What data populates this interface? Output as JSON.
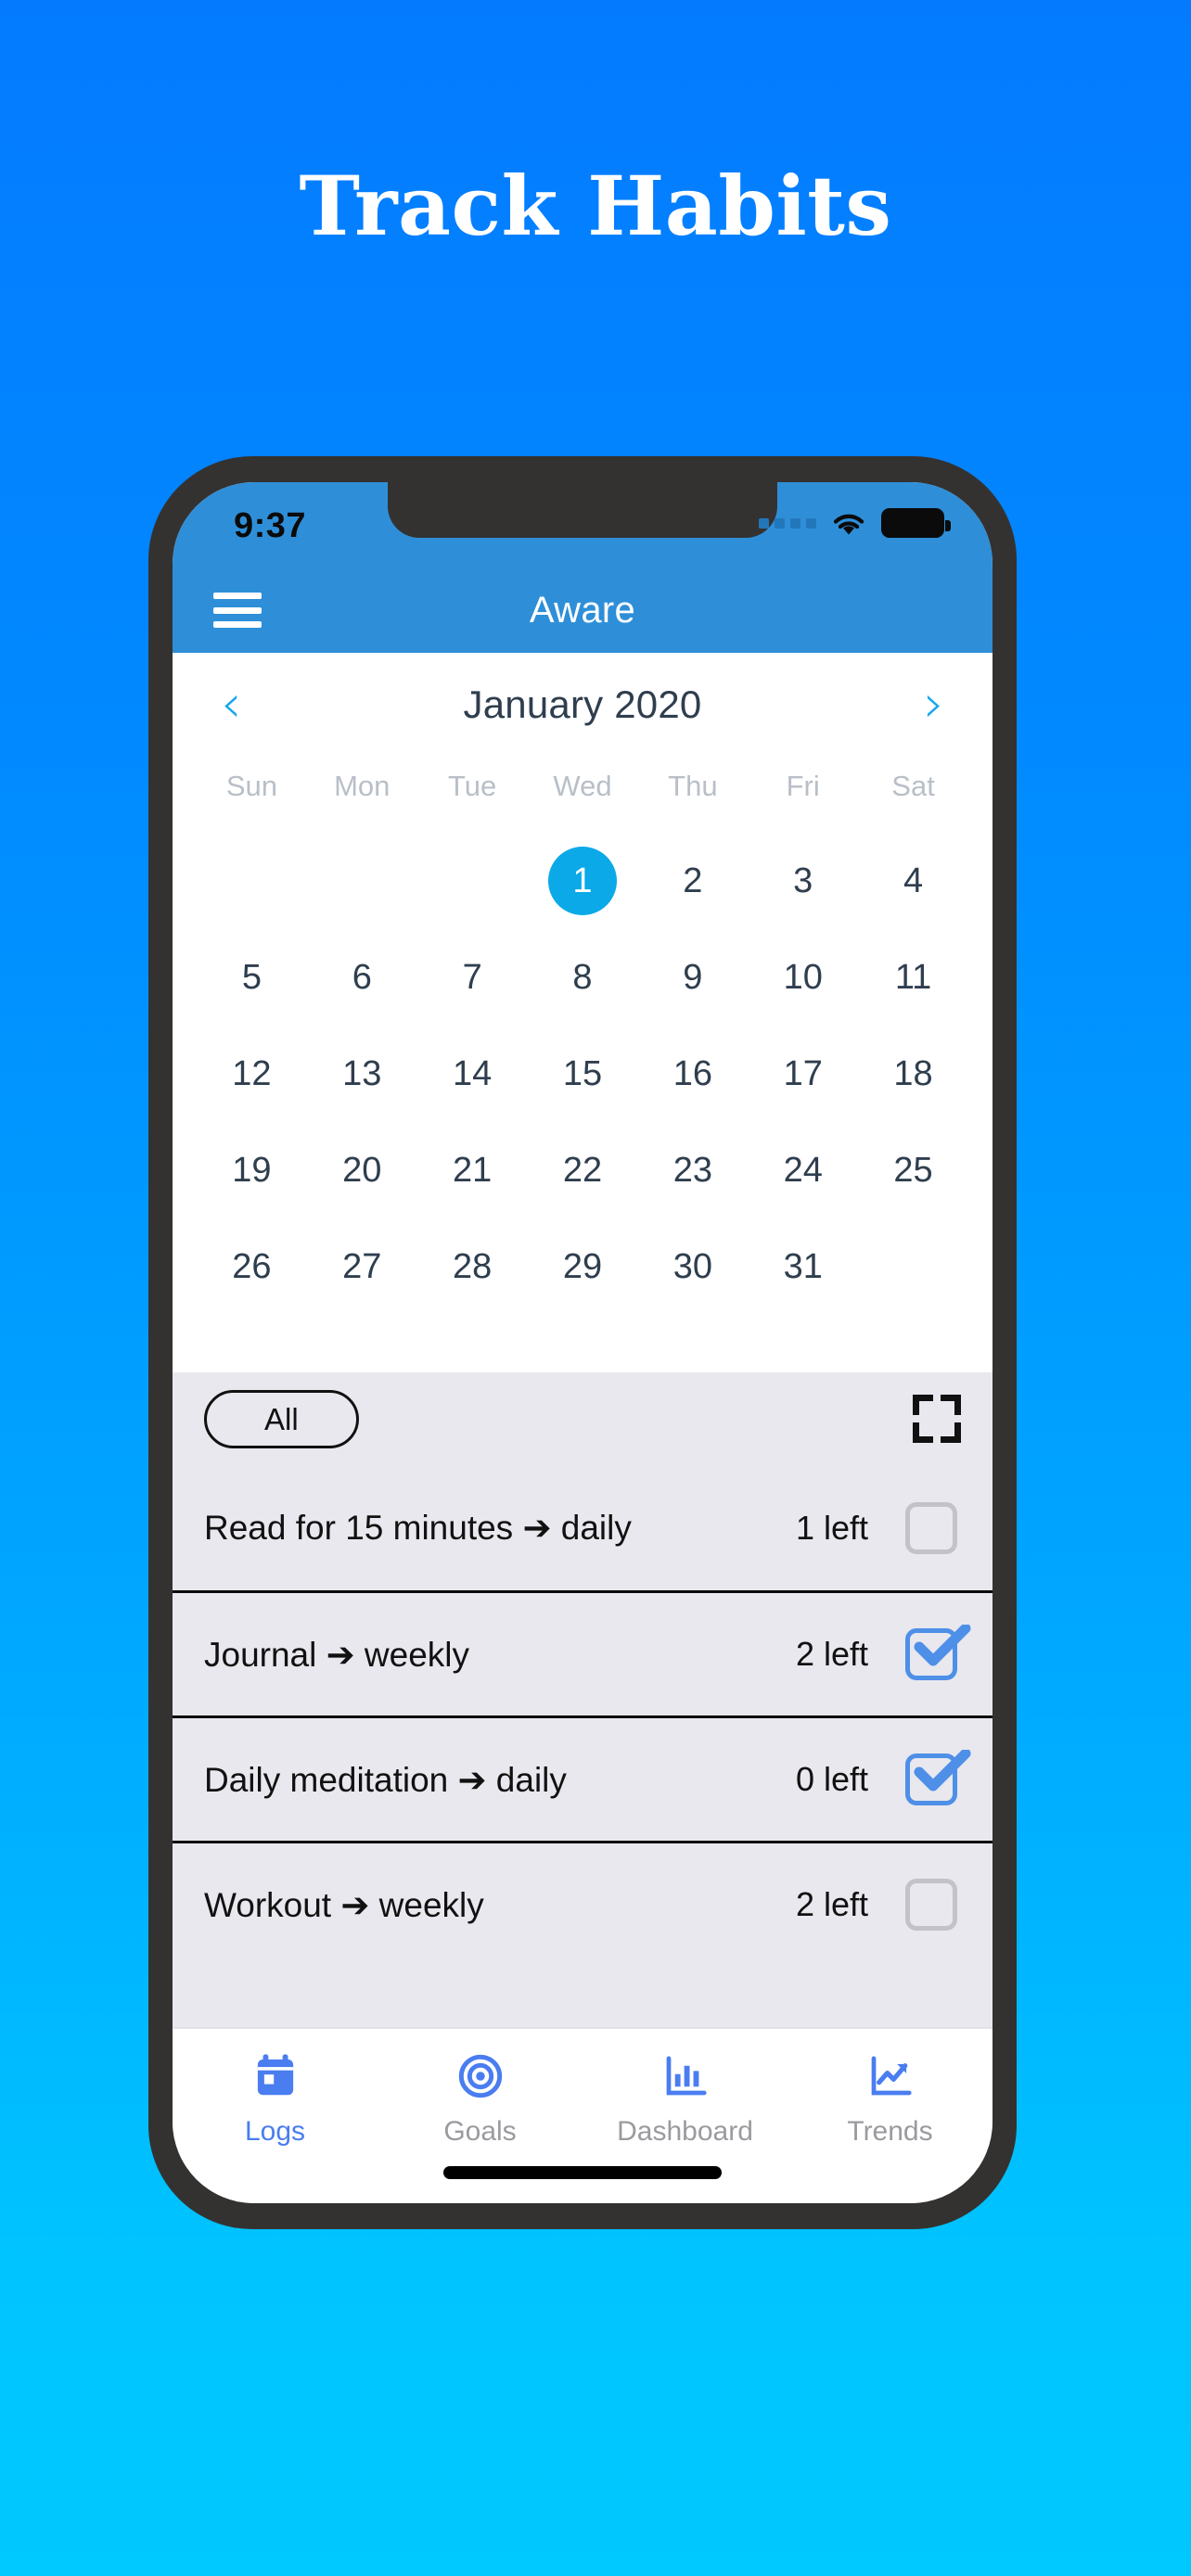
{
  "headline": "Track Habits",
  "theme": {
    "bg_top": "#047BFF",
    "bg_bottom": "#00C9FF",
    "appbar": "#2E8FD8",
    "accent_blue": "#0CA9E8",
    "chevron_blue": "#14A7EC",
    "nav_active": "#4A7DF0",
    "checkbox_checked": "#4E8FE8",
    "list_bg": "#E8E8EE"
  },
  "status_bar": {
    "time": "9:37",
    "signal_dots": 4,
    "wifi_icon": "wifi-icon",
    "battery_icon": "battery-full-icon"
  },
  "app_bar": {
    "menu_icon": "hamburger-menu-icon",
    "title": "Aware"
  },
  "calendar": {
    "prev_icon": "chevron-left-icon",
    "next_icon": "chevron-right-icon",
    "month_label": "January 2020",
    "weekdays": [
      "Sun",
      "Mon",
      "Tue",
      "Wed",
      "Thu",
      "Fri",
      "Sat"
    ],
    "leading_blanks": 3,
    "days": [
      1,
      2,
      3,
      4,
      5,
      6,
      7,
      8,
      9,
      10,
      11,
      12,
      13,
      14,
      15,
      16,
      17,
      18,
      19,
      20,
      21,
      22,
      23,
      24,
      25,
      26,
      27,
      28,
      29,
      30,
      31
    ],
    "selected_day": 1
  },
  "filter_bar": {
    "filter_label": "All",
    "expand_icon": "fullscreen-expand-icon"
  },
  "habits": [
    {
      "name": "Read for 15 minutes ➔ daily",
      "left": "1 left",
      "checked": false
    },
    {
      "name": "Journal ➔ weekly",
      "left": "2 left",
      "checked": true
    },
    {
      "name": "Daily meditation ➔ daily",
      "left": "0 left",
      "checked": true
    },
    {
      "name": "Workout ➔ weekly",
      "left": "2 left",
      "checked": false
    }
  ],
  "bottom_nav": [
    {
      "label": "Logs",
      "icon": "calendar-icon",
      "active": true
    },
    {
      "label": "Goals",
      "icon": "target-icon",
      "active": false
    },
    {
      "label": "Dashboard",
      "icon": "bar-chart-icon",
      "active": false
    },
    {
      "label": "Trends",
      "icon": "line-chart-icon",
      "active": false
    }
  ]
}
